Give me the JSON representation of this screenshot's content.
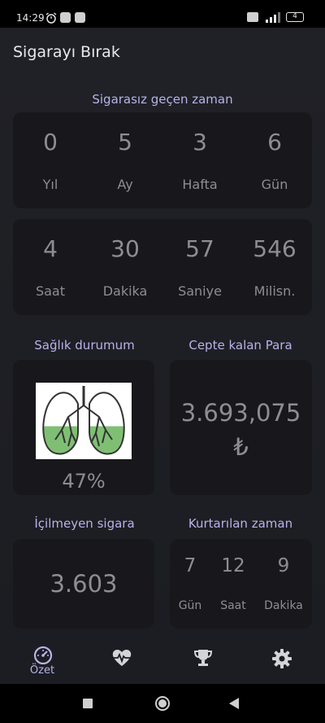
{
  "status": {
    "time": "14:29",
    "battery": "4"
  },
  "app": {
    "title": "Sigarayı Bırak"
  },
  "smokefree": {
    "title": "Sigarasız geçen zaman",
    "row1": [
      {
        "value": "0",
        "label": "Yıl"
      },
      {
        "value": "5",
        "label": "Ay"
      },
      {
        "value": "3",
        "label": "Hafta"
      },
      {
        "value": "6",
        "label": "Gün"
      }
    ],
    "row2": [
      {
        "value": "4",
        "label": "Saat"
      },
      {
        "value": "30",
        "label": "Dakika"
      },
      {
        "value": "57",
        "label": "Saniye"
      },
      {
        "value": "546",
        "label": "Milisn."
      }
    ]
  },
  "health": {
    "title": "Sağlık durumum",
    "percent": "47%",
    "fill_fraction": 0.47
  },
  "money": {
    "title": "Cepte kalan Para",
    "amount": "3.693,075",
    "currency": "₺"
  },
  "cigs": {
    "title": "İçilmeyen sigara",
    "value": "3.603"
  },
  "saved": {
    "title": "Kurtarılan zaman",
    "items": [
      {
        "value": "7",
        "label": "Gün"
      },
      {
        "value": "12",
        "label": "Saat"
      },
      {
        "value": "9",
        "label": "Dakika"
      }
    ]
  },
  "nav": {
    "summary_label": "Özet"
  },
  "colors": {
    "accent": "#b6b3ea",
    "card": "#18181c",
    "lung_fill": "#7fbf73"
  }
}
